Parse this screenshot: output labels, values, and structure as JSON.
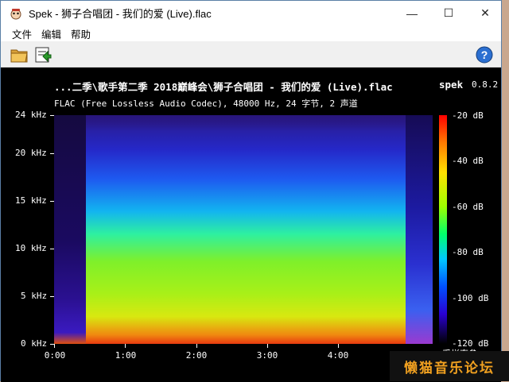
{
  "window": {
    "title": "Spek - 狮子合唱团 - 我们的爱 (Live).flac",
    "controls": {
      "minimize": "—",
      "maximize": "☐",
      "close": "✕"
    }
  },
  "menu": {
    "file": "文件",
    "edit": "编辑",
    "help": "帮助"
  },
  "toolbar": {
    "open_icon": "open-folder-icon",
    "save_icon": "save-image-icon",
    "help_icon": "help-icon"
  },
  "header": {
    "title": "...二季\\歌手第二季 2018巅峰会\\狮子合唱团 - 我们的爱 (Live).flac",
    "subtitle": "FLAC (Free Lossless Audio Codec), 48000 Hz, 24 字节, 2 声道",
    "app_name": "spek",
    "version": "0.8.2"
  },
  "axes": {
    "y": [
      "24 kHz",
      "20 kHz",
      "15 kHz",
      "10 kHz",
      "5 kHz",
      "0 kHz"
    ],
    "x": [
      "0:00",
      "1:00",
      "2:00",
      "3:00",
      "4:00"
    ],
    "db": [
      "-20 dB",
      "-40 dB",
      "-60 dB",
      "-80 dB",
      "-100 dB",
      "-120 dB"
    ]
  },
  "partial_text": "采样率参",
  "watermark": "懒猫音乐论坛",
  "colors": {
    "background": "#000000",
    "text": "#ffffff",
    "watermark": "#f0a020"
  }
}
